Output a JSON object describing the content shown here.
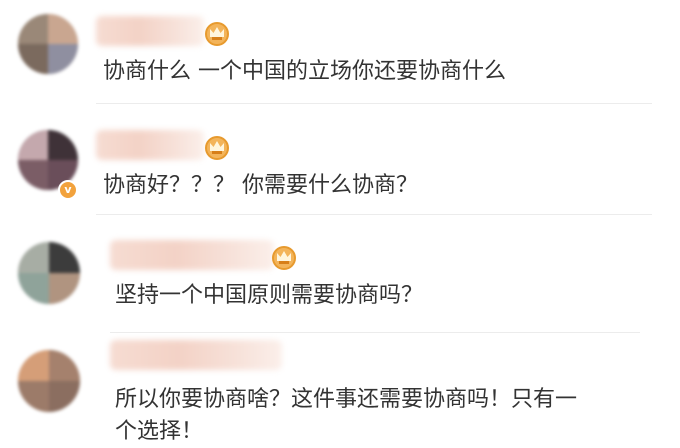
{
  "comments": [
    {
      "text": "协商什么 一个中国的立场你还要协商什么"
    },
    {
      "text": "协商好？？？ 你需要什么协商？",
      "verified_mark": "v"
    },
    {
      "text": "坚持一个中国原则需要协商吗？"
    },
    {
      "text_line1": "所以你要协商啥？这件事还需要协商吗！只有一",
      "text_line2": "个选择！"
    }
  ],
  "colors": {
    "badge": "#f3b45a",
    "text": "#333333",
    "divider": "#ececec"
  },
  "icons": [
    "user-avatar-blurred",
    "vip-crown-icon",
    "verified-v-icon"
  ]
}
